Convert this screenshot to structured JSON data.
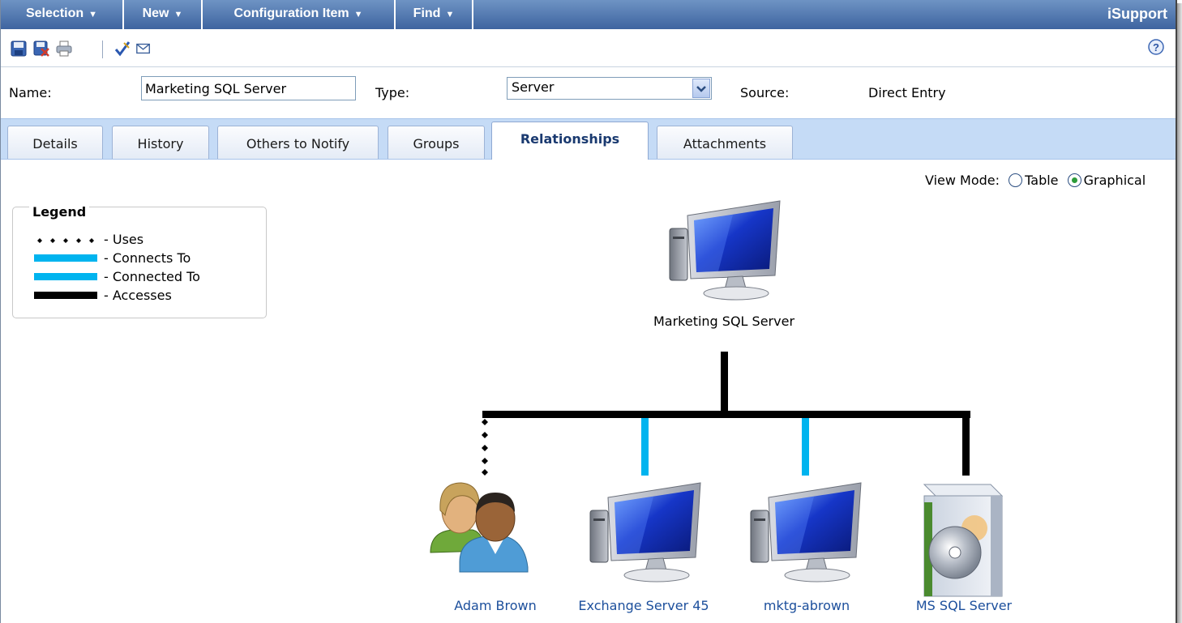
{
  "menubar": {
    "items": [
      "Selection",
      "New",
      "Configuration Item",
      "Find"
    ],
    "brand": "iSupport"
  },
  "toolbar": {
    "icons": [
      "save-icon",
      "save-close-icon",
      "print-icon",
      "spellcheck-icon",
      "email-icon",
      "help-icon"
    ]
  },
  "header": {
    "name_label": "Name:",
    "name_value": "Marketing SQL Server",
    "type_label": "Type:",
    "type_value": "Server",
    "source_label": "Source:",
    "source_value": "Direct Entry"
  },
  "tabs": [
    "Details",
    "History",
    "Others to Notify",
    "Groups",
    "Relationships",
    "Attachments"
  ],
  "active_tab": "Relationships",
  "view_mode": {
    "label": "View Mode:",
    "options": [
      "Table",
      "Graphical"
    ],
    "selected": "Graphical"
  },
  "legend": {
    "title": "Legend",
    "items": [
      {
        "style": "dotted",
        "label": "- Uses",
        "color": "#000000"
      },
      {
        "style": "line",
        "label": "- Connects To",
        "color": "#00b4ef"
      },
      {
        "style": "line",
        "label": "- Connected To",
        "color": "#00b4ef"
      },
      {
        "style": "line",
        "label": "- Accesses",
        "color": "#000000"
      }
    ]
  },
  "diagram": {
    "root": {
      "label": "Marketing SQL Server",
      "icon": "computer-icon"
    },
    "children": [
      {
        "label": "Adam Brown",
        "icon": "users-icon",
        "relation": "Uses"
      },
      {
        "label": "Exchange Server 45",
        "icon": "computer-icon",
        "relation": "Connects To"
      },
      {
        "label": "mktg-abrown",
        "icon": "computer-icon",
        "relation": "Connected To"
      },
      {
        "label": "MS SQL Server",
        "icon": "software-box-icon",
        "relation": "Accesses"
      }
    ]
  }
}
